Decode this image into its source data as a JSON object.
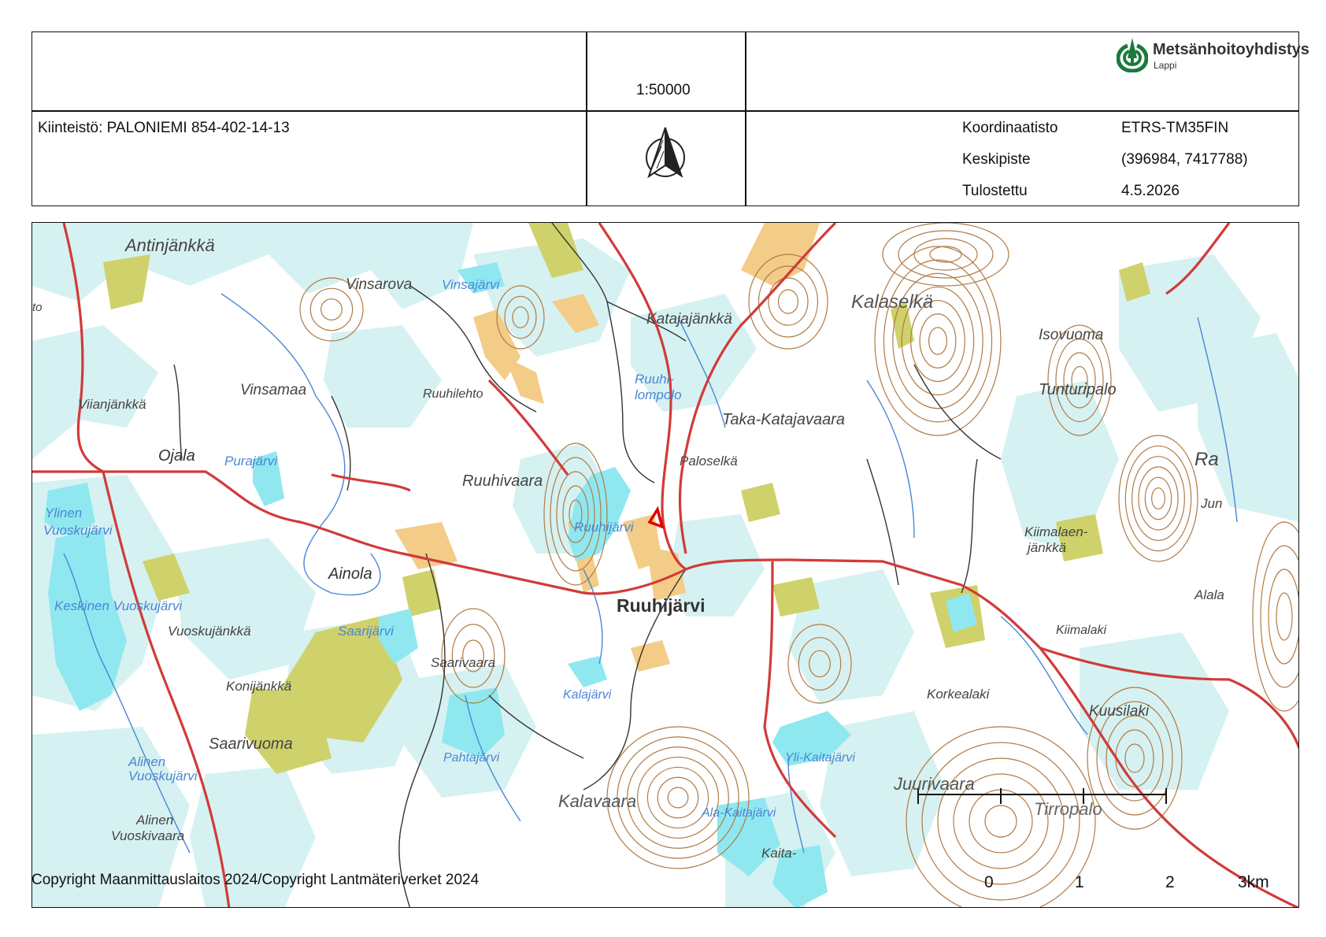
{
  "header": {
    "scale": "1:50000",
    "property": "Kiinteistö: PALONIEMI 854-402-14-13",
    "info": [
      {
        "label": "Koordinaatisto",
        "value": "ETRS-TM35FIN"
      },
      {
        "label": "Keskipiste",
        "value": "(396984, 7417788)"
      },
      {
        "label": "Tulostettu",
        "value": "4.5.2026"
      }
    ],
    "logo": {
      "title": "Metsänhoitoyhdistys",
      "subtitle": "Lappi",
      "icon": "forest-logo-icon",
      "color": "#1a7a3c"
    }
  },
  "map": {
    "colors": {
      "water": "#8fe8ef",
      "wetland": "#d6f1f1",
      "field": "#f3cc87",
      "meadow": "#cfd16a",
      "contour": "#b07a45",
      "road": "#d23a3a",
      "stream": "#4a86d6",
      "parcel": "#e00000"
    },
    "place_labels": [
      "Antinjänkkä",
      "Vinsarova",
      "Vinsajärvi",
      "Katajajänkkä",
      "Kalaselkä",
      "Isovuoma",
      "Vinsamaa",
      "Ruuhilehto",
      "Ruuhi-",
      "lompolo",
      "Taka-Katajavaara",
      "Tunturipalo",
      "Viianjänkkä",
      "Ojala",
      "Purajärvi",
      "Ruuhivaara",
      "Paloselkä",
      "Ylinen",
      "Vuoskujärvi",
      "Ruuhijärvi",
      "Kiimalaen-",
      "jänkkä",
      "Ainola",
      "Keskinen Vuoskujärvi",
      "Vuoskujänkkä",
      "Saarijärvi",
      "Saarivaara",
      "Kiimalaki",
      "Konijänkkä",
      "Kalajärvi",
      "Korkealaki",
      "Kuusilaki",
      "Saarivuoma",
      "Pahtajärvi",
      "Yli-Kaitajärvi",
      "Alinen",
      "Vuoskujärvi",
      "Juurivaara",
      "Kalavaara",
      "Ala-Kaitajärvi",
      "Tirropalo",
      "Alinen",
      "Vuoskivaara",
      "Kaita-",
      "Ra",
      "Jun",
      "Alala",
      "to"
    ],
    "village_label": "Ruuhijärvi"
  },
  "scalebar": {
    "ticks": [
      "0",
      "1",
      "2",
      "3km"
    ]
  },
  "copyright": "Copyright Maanmittauslaitos 2024/Copyright Lantmäteriverket 2024"
}
